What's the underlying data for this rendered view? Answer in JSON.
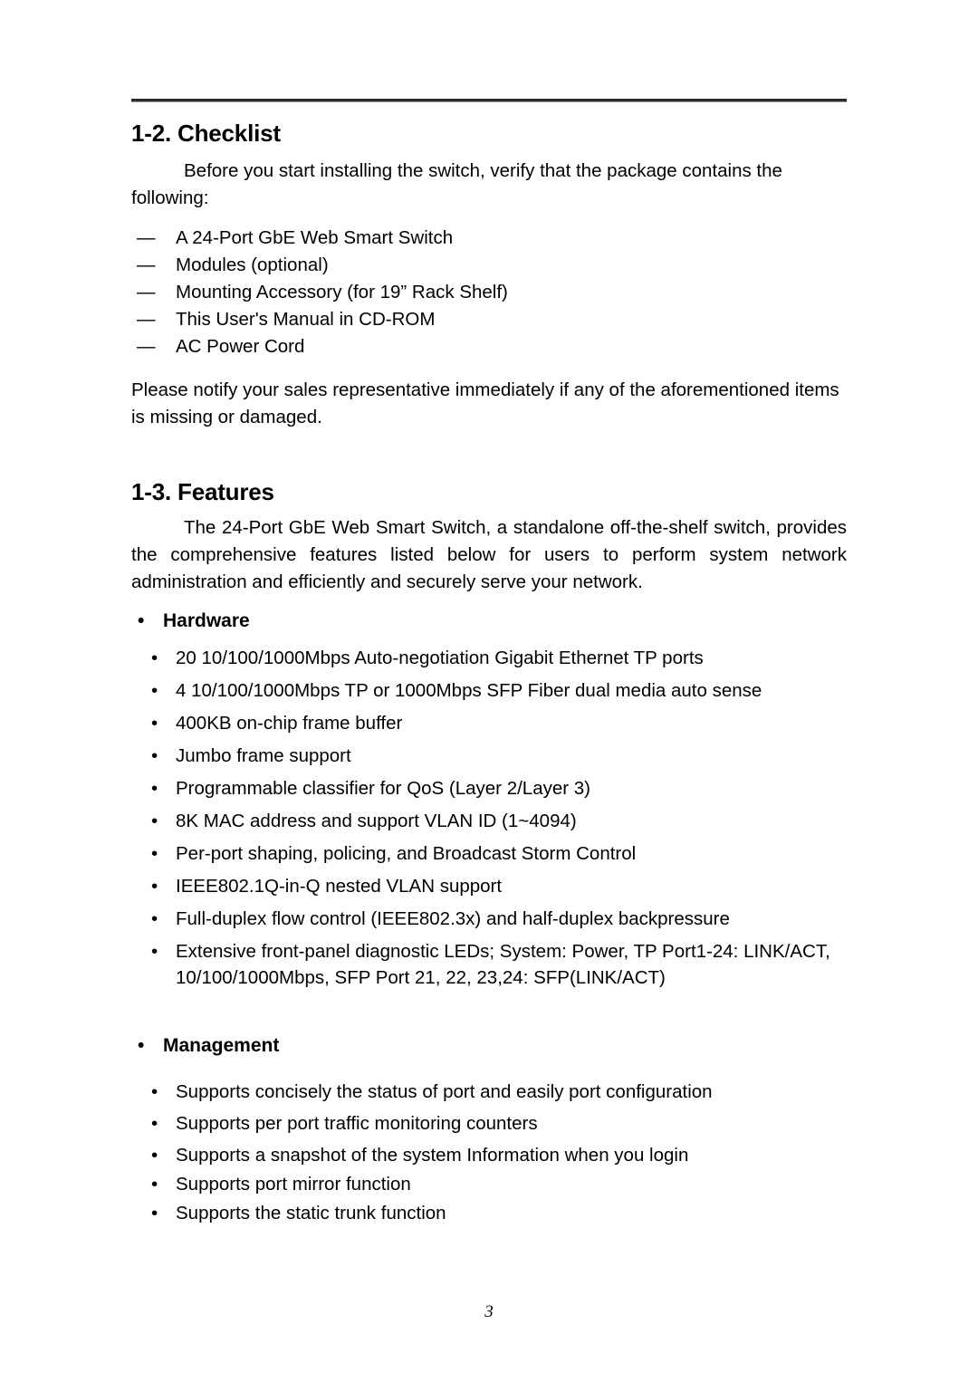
{
  "document": {
    "page_number": "3"
  },
  "sections": {
    "checklist": {
      "heading": "1-2. Checklist",
      "intro": "Before you start installing the switch, verify that the package contains the following:",
      "items": [
        "A 24-Port GbE Web Smart Switch",
        "Modules (optional)",
        "Mounting Accessory (for 19” Rack Shelf)",
        "This User's Manual in CD-ROM",
        "AC Power Cord"
      ],
      "dash_glyph": "—",
      "note": "Please notify your sales representative immediately if any of the aforementioned items is missing or damaged."
    },
    "features": {
      "heading": "1-3. Features",
      "intro": "The 24-Port GbE Web Smart Switch, a standalone off-the-shelf switch, provides the comprehensive features listed below for users to perform system network administration and efficiently and securely serve your network.",
      "bullet_glyph": "•",
      "hardware": {
        "heading": "Hardware",
        "items": [
          "20 10/100/1000Mbps Auto-negotiation Gigabit Ethernet TP ports",
          "4 10/100/1000Mbps TP or 1000Mbps SFP Fiber dual media auto sense",
          "400KB on-chip frame buffer",
          "Jumbo frame support",
          "Programmable classifier for QoS (Layer 2/Layer 3)",
          "8K MAC address and support VLAN ID (1~4094)",
          "Per-port shaping, policing, and Broadcast Storm Control",
          "IEEE802.1Q-in-Q nested VLAN support",
          "Full-duplex flow control (IEEE802.3x) and half-duplex backpressure",
          "Extensive front-panel diagnostic LEDs; System: Power, TP Port1-24:  LINK/ACT, 10/100/1000Mbps, SFP Port 21, 22, 23,24: SFP(LINK/ACT)"
        ]
      },
      "management": {
        "heading": "Management",
        "items": [
          "Supports concisely the status of port and easily port configuration",
          "Supports per port traffic monitoring counters",
          "Supports a snapshot of the system Information when you login",
          "Supports port mirror function",
          "Supports the static trunk function"
        ]
      }
    }
  }
}
